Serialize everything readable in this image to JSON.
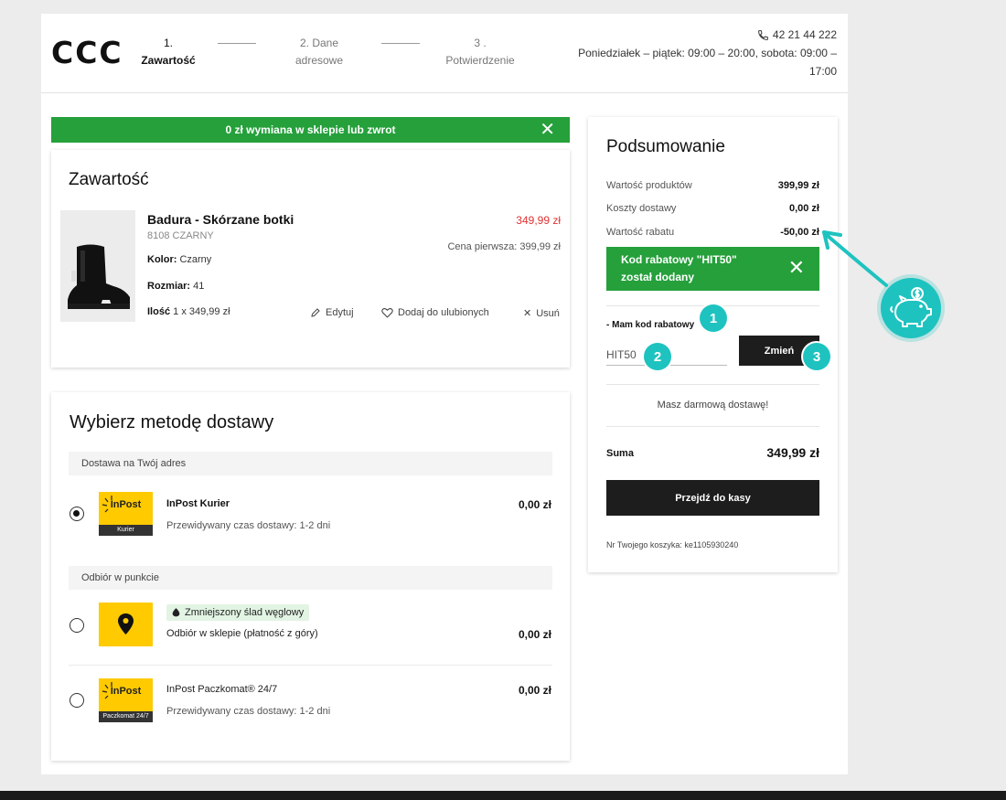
{
  "header": {
    "logo": "CCC",
    "steps": [
      {
        "num": "1.",
        "label": "Zawartość"
      },
      {
        "num": "2. Dane",
        "label": "adresowe"
      },
      {
        "num": "3 .",
        "label": "Potwierdzenie"
      }
    ],
    "phone": "42 21 44 222",
    "hours_line1": "Poniedziałek – piątek: 09:00 – 20:00, sobota: 09:00 –",
    "hours_line2": "17:00"
  },
  "promo_banner": "0 zł wymiana w sklepie lub zwrot",
  "content": {
    "title": "Zawartość",
    "product": {
      "name": "Badura - Skórzane botki",
      "code": "8108 CZARNY",
      "color_label": "Kolor:",
      "color_value": "Czarny",
      "size_label": "Rozmiar:",
      "size_value": "41",
      "qty_label": "Ilość",
      "qty_value": "1 x 349,99 zł",
      "price": "349,99 zł",
      "first_price": "Cena pierwsza: 399,99 zł"
    },
    "actions": {
      "edit": "Edytuj",
      "favorite": "Dodaj do ulubionych",
      "remove": "Usuń"
    }
  },
  "delivery": {
    "title": "Wybierz metodę dostawy",
    "group1_label": "Dostawa na Twój adres",
    "group2_label": "Odbiór w punkcie",
    "options": [
      {
        "logo_text": "InPost",
        "logo_strip": "Kurier",
        "name": "InPost Kurier",
        "sub": "Przewidywany czas dostawy: 1-2 dni",
        "price": "0,00 zł"
      },
      {
        "badge": "Zmniejszony ślad węglowy",
        "name": "Odbiór w sklepie (płatność z góry)",
        "price": "0,00 zł"
      },
      {
        "logo_text": "InPost",
        "logo_strip": "Paczkomat 24/7",
        "name": "InPost Paczkomat® 24/7",
        "sub": "Przewidywany czas dostawy: 1-2 dni",
        "price": "0,00 zł"
      }
    ]
  },
  "summary": {
    "title": "Podsumowanie",
    "rows": [
      {
        "label": "Wartość produktów",
        "value": "399,99 zł"
      },
      {
        "label": "Koszty dostawy",
        "value": "0,00 zł"
      },
      {
        "label": "Wartość rabatu",
        "value": "-50,00 zł"
      }
    ],
    "code_banner_line1": "Kod rabatowy \"HIT50\"",
    "code_banner_line2": "został dodany",
    "code_label": "- Mam kod rabatowy",
    "code_value": "HIT50",
    "change_button": "Zmień",
    "free_delivery": "Masz darmową dostawę!",
    "total_label": "Suma",
    "total_value": "349,99 zł",
    "checkout_button": "Przejdź do kasy",
    "cart_number": "Nr Twojego koszyka: ke1105930240"
  },
  "markers": [
    "1",
    "2",
    "3"
  ],
  "colors": {
    "green": "#25a03b",
    "teal": "#1ec3c0",
    "price_red": "#e03131",
    "dark_button": "#1d1d1d",
    "inpost_yellow": "#ffca00"
  }
}
